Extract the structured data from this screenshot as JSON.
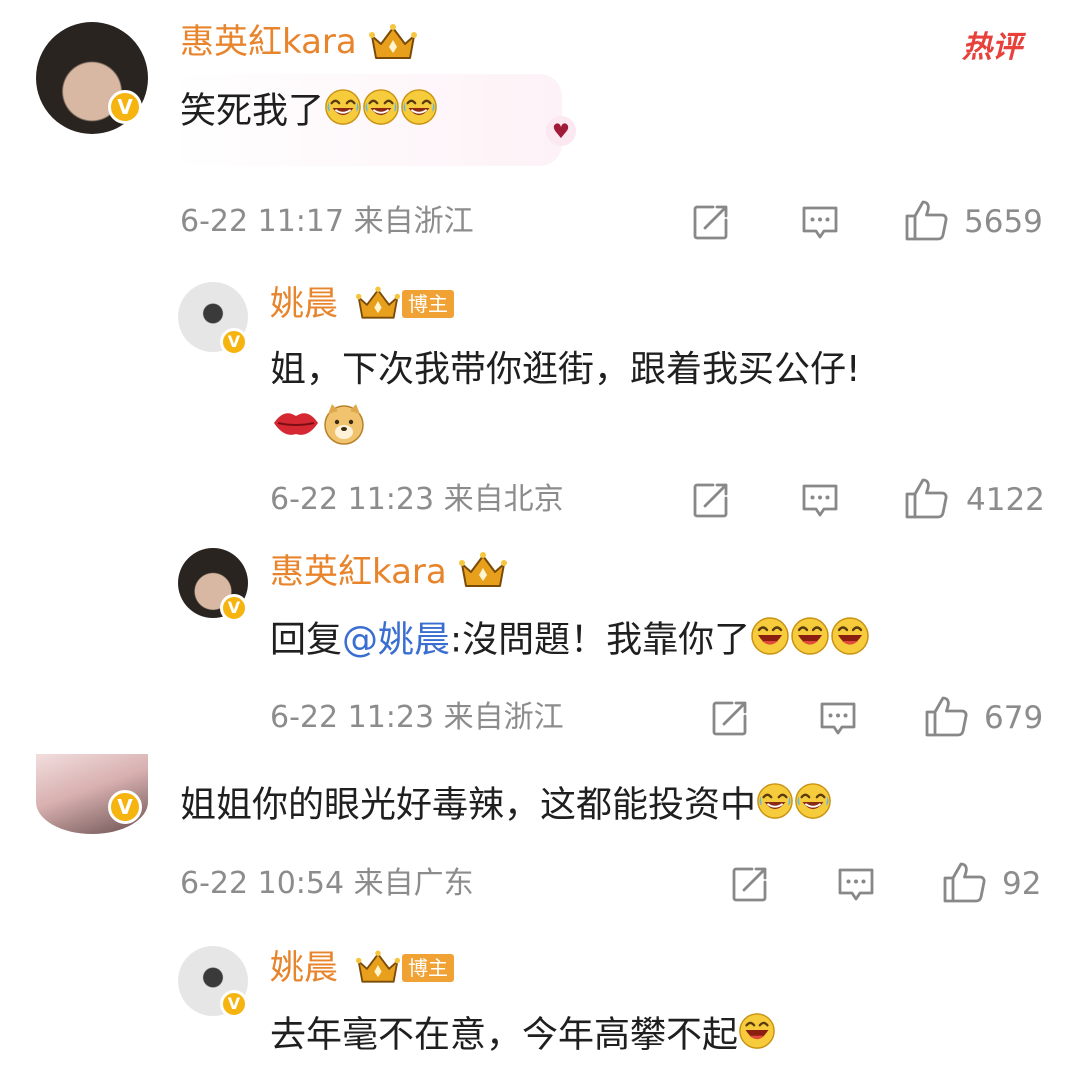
{
  "comments": [
    {
      "name": "惠英紅kara",
      "badge": "热评",
      "text": "笑死我了",
      "time": "6-22 11:17",
      "location": "来自浙江",
      "likes": "5659",
      "replies": [
        {
          "name": "姚晨",
          "tag": "博主",
          "text": "姐，下次我带你逛街，跟着我买公仔!",
          "time": "6-22 11:23",
          "location": "来自北京",
          "likes": "4122"
        },
        {
          "name": "惠英紅kara",
          "reply_prefix": "回复",
          "mention": "@姚晨",
          "text": ":沒問題！我靠你了",
          "time": "6-22 11:23",
          "location": "来自浙江",
          "likes": "679"
        }
      ]
    },
    {
      "text": "姐姐你的眼光好毒辣，这都能投资中",
      "time": "6-22 10:54",
      "location": "来自广东",
      "likes": "92",
      "replies": [
        {
          "name": "姚晨",
          "tag": "博主",
          "text": "去年毫不在意，今年高攀不起"
        }
      ]
    }
  ],
  "icons": {
    "share": "share-icon",
    "comment": "comment-icon",
    "like": "thumbs-up-icon",
    "verified": "verified-v-badge",
    "crown": "crown-icon"
  },
  "colors": {
    "name": "#e8842c",
    "mention": "#3a6fd1",
    "meta": "#8c8c8c",
    "text": "#1f1f1f",
    "hot": "#e8413b",
    "verified": "#f5b40f"
  }
}
